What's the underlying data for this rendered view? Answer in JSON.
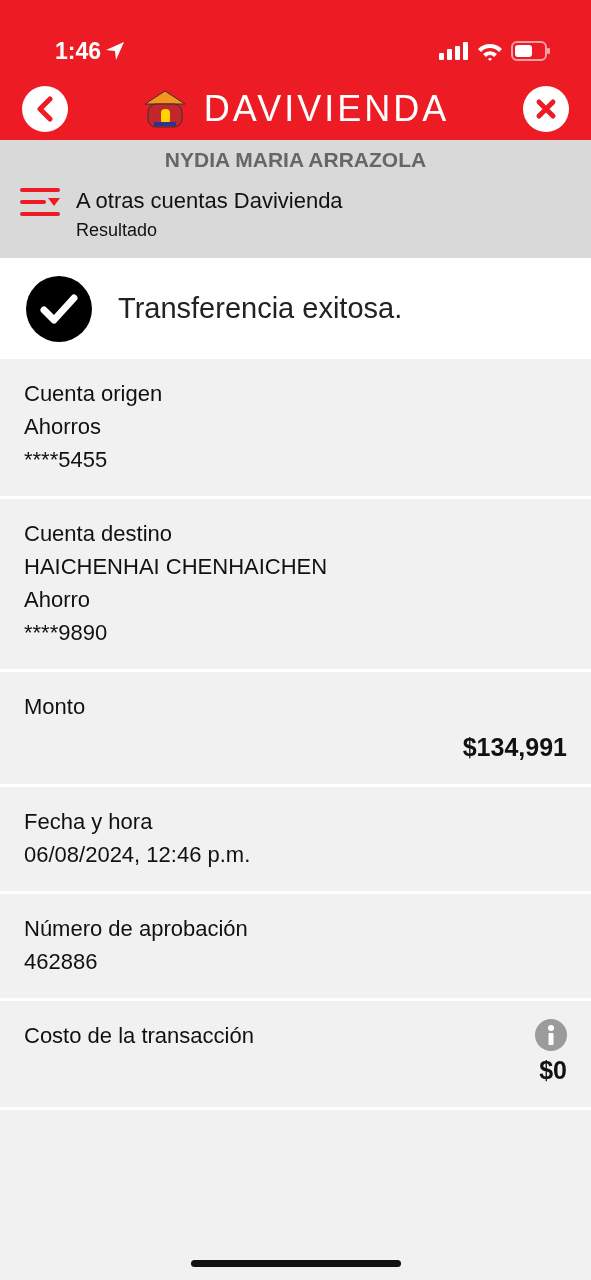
{
  "status_bar": {
    "time": "1:46"
  },
  "header": {
    "brand": "DAVIVIENDA"
  },
  "user": {
    "name": "NYDIA MARIA ARRAZOLA"
  },
  "section": {
    "title": "A otras cuentas Davivienda",
    "subtitle": "Resultado"
  },
  "result": {
    "message": "Transferencia exitosa."
  },
  "details": [
    {
      "label": "Cuenta origen",
      "lines": [
        "Ahorros",
        "****5455"
      ]
    },
    {
      "label": "Cuenta destino",
      "lines": [
        "HAICHENHAI CHENHAICHEN",
        "Ahorro",
        "****9890"
      ]
    },
    {
      "label": "Monto",
      "amount": "$134,991"
    },
    {
      "label": "Fecha y hora",
      "lines": [
        "06/08/2024, 12:46 p.m."
      ]
    },
    {
      "label": "Número de aprobación",
      "lines": [
        "462886"
      ]
    },
    {
      "label": "Costo de la transacción",
      "amount": "$0",
      "info": true
    }
  ]
}
